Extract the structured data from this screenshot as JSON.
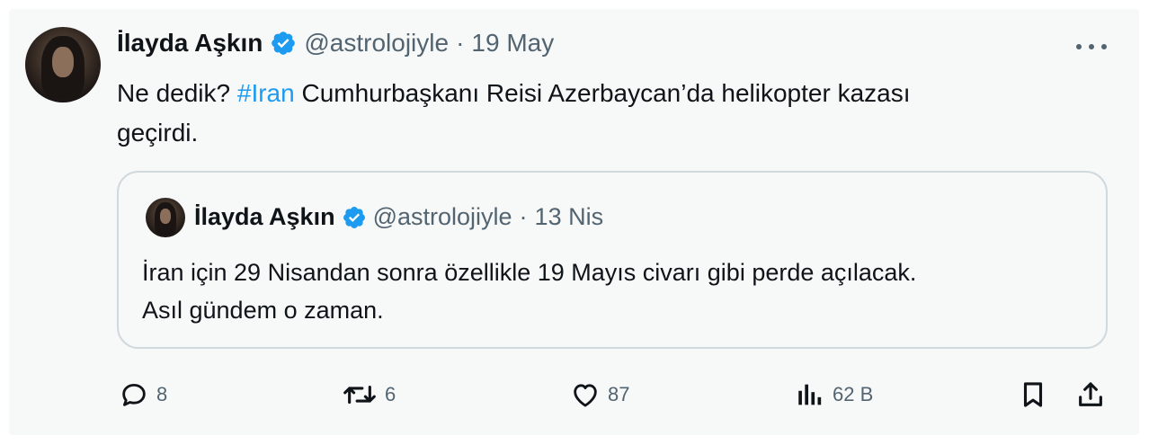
{
  "tweet": {
    "author_name": "İlayda Aşkın",
    "handle": "@astrolojiyle",
    "separator": "·",
    "date": "19 May",
    "text_prefix": "Ne dedik? ",
    "hashtag": "#Iran",
    "text_line1_rest": " Cumhurbaşkanı Reisi Azerbaycan’da helikopter kazası",
    "text_line2": "geçirdi."
  },
  "quoted_tweet": {
    "author_name": "İlayda Aşkın",
    "handle": "@astrolojiyle",
    "separator": "·",
    "date": "13 Nis",
    "text_line1": "İran için 29 Nisandan sonra özellikle 19 Mayıs civarı gibi perde açılacak.",
    "text_line2": "Asıl gündem o zaman."
  },
  "actions": {
    "replies": "8",
    "reposts": "6",
    "likes": "87",
    "views": "62 B"
  },
  "icons": {
    "verified": "verified-badge-icon",
    "more": "more-dots-icon",
    "reply": "reply-icon",
    "repost": "repost-icon",
    "like": "heart-icon",
    "views": "views-chart-icon",
    "bookmark": "bookmark-icon",
    "share": "share-icon"
  },
  "colors": {
    "accent": "#1d9bf0",
    "text": "#0f1419",
    "muted": "#536471",
    "border": "#cfd9de"
  }
}
